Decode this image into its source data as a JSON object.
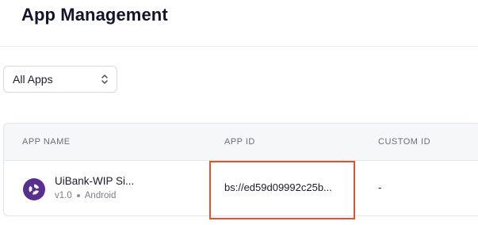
{
  "page": {
    "title": "App Management"
  },
  "filter": {
    "selected": "All Apps",
    "icon": "chevron-up-down-icon"
  },
  "table": {
    "columns": [
      "APP NAME",
      "APP ID",
      "CUSTOM ID"
    ],
    "rows": [
      {
        "name": "UiBank-WIP Si...",
        "version": "v1.0",
        "platform": "Android",
        "app_id": "bs://ed59d09992c25b...",
        "custom_id": "-",
        "logo_icon": "app-logo-icon"
      }
    ]
  },
  "colors": {
    "highlight": "#e0532f",
    "logo": "#5a2e8f"
  }
}
